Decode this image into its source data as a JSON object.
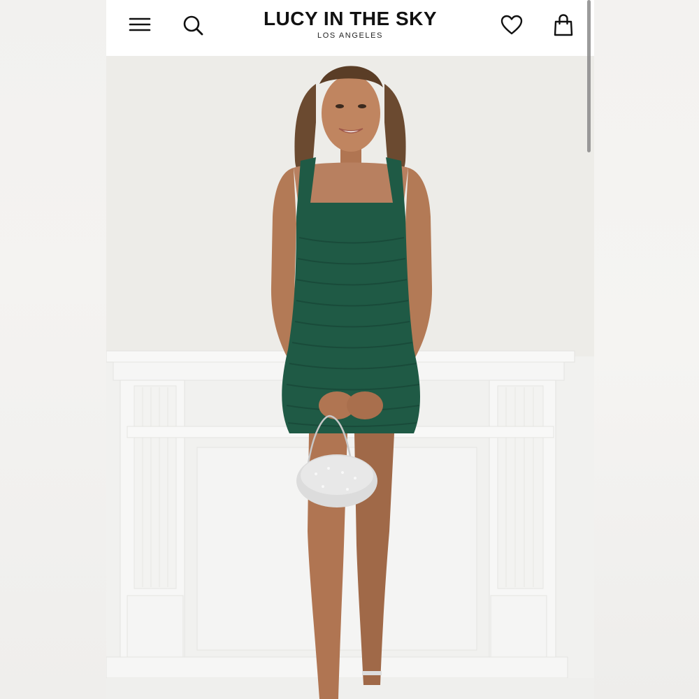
{
  "brand": {
    "name": "LUCY IN THE SKY",
    "location": "LOS ANGELES"
  },
  "header": {
    "icons": [
      "menu-icon",
      "search-icon",
      "heart-icon",
      "shopping-bag-icon"
    ]
  },
  "product_image": {
    "dress_color": "#1f5a45",
    "background_color": "#eeede9"
  }
}
